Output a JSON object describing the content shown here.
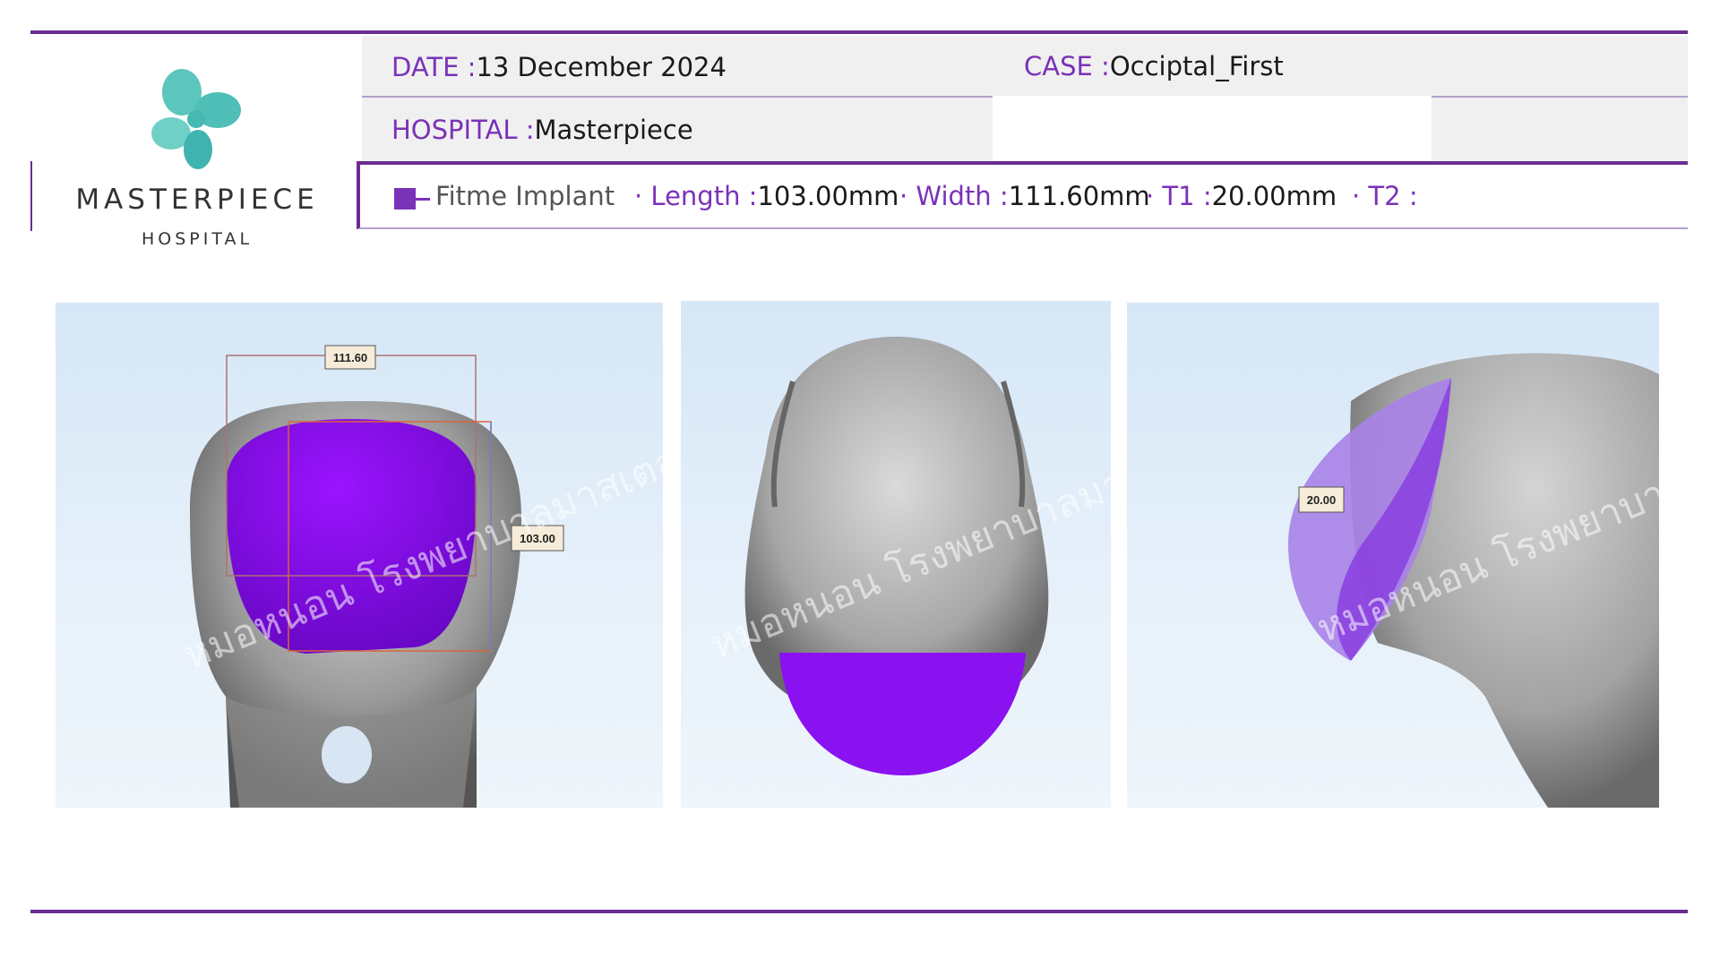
{
  "logo": {
    "name": "MASTERPIECE",
    "subtitle": "HOSPITAL",
    "mark_colors": [
      "#5cc6bd",
      "#3fb3b0"
    ]
  },
  "header": {
    "date_label": "DATE :",
    "date_value": "13 December 2024",
    "case_label": "CASE :",
    "case_value": "Occiptal_First",
    "hospital_label": "HOSPITAL :",
    "hospital_value": "Masterpiece"
  },
  "implant": {
    "name": "Fitme Implant",
    "length_label": "· Length :",
    "length_value": "103.00mm",
    "width_label": "· Width :",
    "width_value": "111.60mm",
    "t1_label": "· T1 :",
    "t1_value": "20.00mm",
    "t2_label": "· T2 :",
    "t2_value": ""
  },
  "views": {
    "front": {
      "width_dim": "111.60",
      "length_dim": "103.00"
    },
    "side": {
      "thickness_dim": "20.00"
    },
    "watermark": "หมอหนอน โรงพยาบาลมาสเตอร์พีซ"
  },
  "colors": {
    "accent": "#6a2c91",
    "label": "#7a32b8",
    "implant": "#8a12f0"
  }
}
